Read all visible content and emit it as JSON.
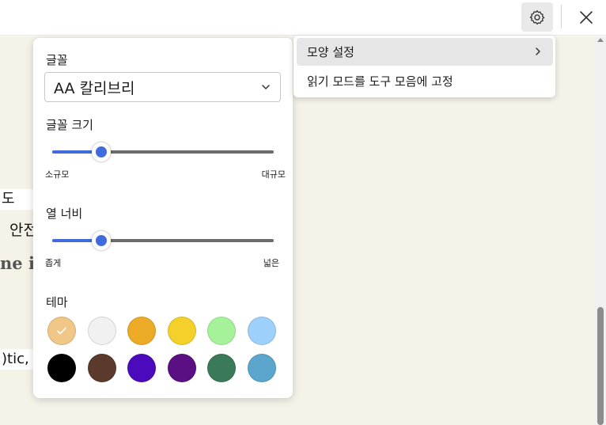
{
  "menu": {
    "items": [
      {
        "label": "모양 설정",
        "has_submenu": true
      },
      {
        "label": "읽기 모드를 도구 모음에 고정"
      }
    ]
  },
  "panel": {
    "font": {
      "label": "글꼴",
      "value": "AA 칼리브리"
    },
    "font_size": {
      "label": "글꼴 크기",
      "min_label": "소규모",
      "max_label": "대규모",
      "value_fraction": 0.22
    },
    "column_width": {
      "label": "열 너비",
      "min_label": "좁게",
      "max_label": "넓은",
      "value_fraction": 0.22
    },
    "theme": {
      "label": "테마",
      "selected_index": 0,
      "colors": [
        "#f0c787",
        "#f1f1f1",
        "#ecab26",
        "#f3d02a",
        "#a6f29b",
        "#9dd0fb",
        "#000000",
        "#5b3a2c",
        "#4b0bbd",
        "#5a0f82",
        "#3a7a58",
        "#5ca5cd"
      ]
    }
  },
  "background_text": {
    "frag1": "도",
    "frag2": "안전",
    "frag3": "ne i",
    "frag4": ")tic,"
  },
  "icons": {
    "settings": "gear-icon",
    "close": "close-icon",
    "dropdown": "chevron-down-icon",
    "submenu": "chevron-right-icon",
    "check": "check-icon"
  }
}
